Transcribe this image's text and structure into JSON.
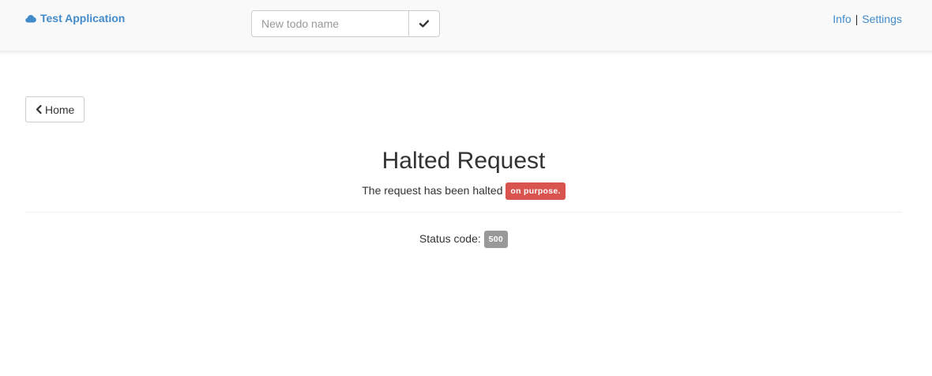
{
  "header": {
    "brand_label": "Test Application",
    "todo_placeholder": "New todo name",
    "nav_info": "Info",
    "nav_separator": "|",
    "nav_settings": "Settings"
  },
  "main": {
    "home_button_label": "Home",
    "title": "Halted Request",
    "subtitle_text": "The request has been halted",
    "subtitle_badge": "on purpose.",
    "status_label": "Status code:",
    "status_code": "500"
  },
  "colors": {
    "link": "#428bca",
    "danger_badge": "#d9534f",
    "default_badge": "#999999"
  },
  "icons": {
    "brand": "cloud-icon",
    "submit": "check-icon",
    "home": "chevron-left-icon"
  }
}
